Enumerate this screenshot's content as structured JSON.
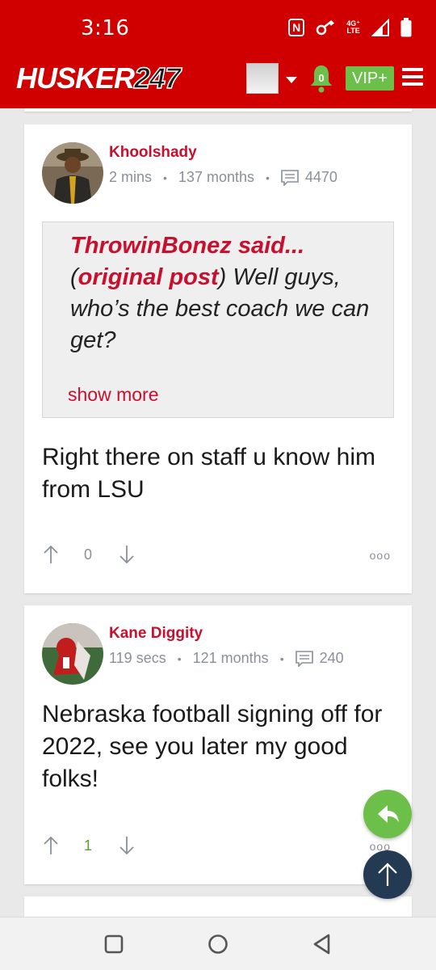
{
  "status_bar": {
    "time": "3:16",
    "network_label_top": "4G⁺",
    "network_label_bottom": "LTE"
  },
  "header": {
    "logo_text": "HUSKER",
    "logo_number": "247",
    "notification_count": "0",
    "vip_label": "VIP+"
  },
  "posts": [
    {
      "author": "Khoolshady",
      "time_ago": "2 mins",
      "tenure": "137 months",
      "post_count": "4470",
      "quote": {
        "quoted_user": "ThrowinBonez said...",
        "open_paren": "(",
        "link_text": "original post",
        "close_paren": ")",
        "text": " Well guys, who’s the best coach we can get?",
        "show_more": "show more"
      },
      "body": "Right there on staff u know him from LSU",
      "votes": "0",
      "more": "ooo"
    },
    {
      "author": "Kane Diggity",
      "time_ago": "119 secs",
      "tenure": "121 months",
      "post_count": "240",
      "body": "Nebraska football signing off for 2022, see you later my good folks!",
      "votes": "1",
      "more": "ooo"
    }
  ],
  "colors": {
    "brand_red": "#d00000",
    "author_red": "#c8102e",
    "vip_green": "#6cc04a",
    "scroll_top_navy": "#233a52"
  }
}
